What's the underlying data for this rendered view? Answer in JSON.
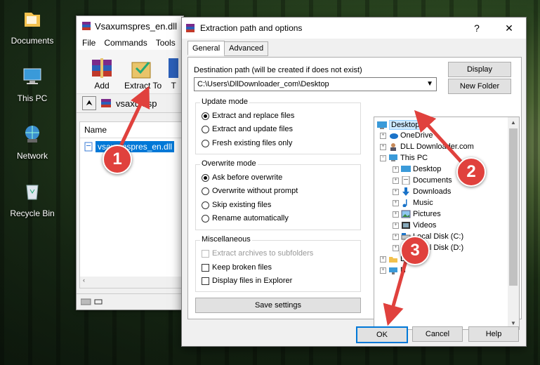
{
  "desktop": {
    "icons": [
      {
        "label": "Documents"
      },
      {
        "label": "This PC"
      },
      {
        "label": "Network"
      },
      {
        "label": "Recycle Bin"
      }
    ]
  },
  "winrar": {
    "title": "Vsaxumspres_en.dll",
    "menu": [
      "File",
      "Commands",
      "Tools"
    ],
    "toolbar": {
      "add": "Add",
      "extract_to": "Extract To",
      "third": "T"
    },
    "path_fragment": "vsaxumsp",
    "list_header": "Name",
    "file_name": "vsaxumspres_en.dll"
  },
  "dialog": {
    "title": "Extraction path and options",
    "help_btn": "?",
    "close_btn": "✕",
    "tabs": [
      "General",
      "Advanced"
    ],
    "destination_label": "Destination path (will be created if does not exist)",
    "destination_value": "C:\\Users\\DllDownloader_com\\Desktop",
    "display_btn": "Display",
    "new_folder_btn": "New Folder",
    "update_mode": {
      "title": "Update mode",
      "options": [
        "Extract and replace files",
        "Extract and update files",
        "Fresh existing files only"
      ],
      "selected": 0
    },
    "overwrite_mode": {
      "title": "Overwrite mode",
      "options": [
        "Ask before overwrite",
        "Overwrite without prompt",
        "Skip existing files",
        "Rename automatically"
      ],
      "selected": 0
    },
    "misc": {
      "title": "Miscellaneous",
      "options": [
        "Extract archives to subfolders",
        "Keep broken files",
        "Display files in Explorer"
      ]
    },
    "save_settings_btn": "Save settings",
    "tree": [
      "Desktop",
      "OneDrive",
      "DLL Downloader.com",
      "This PC",
      "Desktop",
      "Documents",
      "Downloads",
      "Music",
      "Pictures",
      "Videos",
      "Local Disk (C:)",
      "Local Disk (D:)",
      "Li",
      "N"
    ],
    "ok_btn": "OK",
    "cancel_btn": "Cancel",
    "help_footer_btn": "Help"
  },
  "annotations": [
    "1",
    "2",
    "3"
  ]
}
